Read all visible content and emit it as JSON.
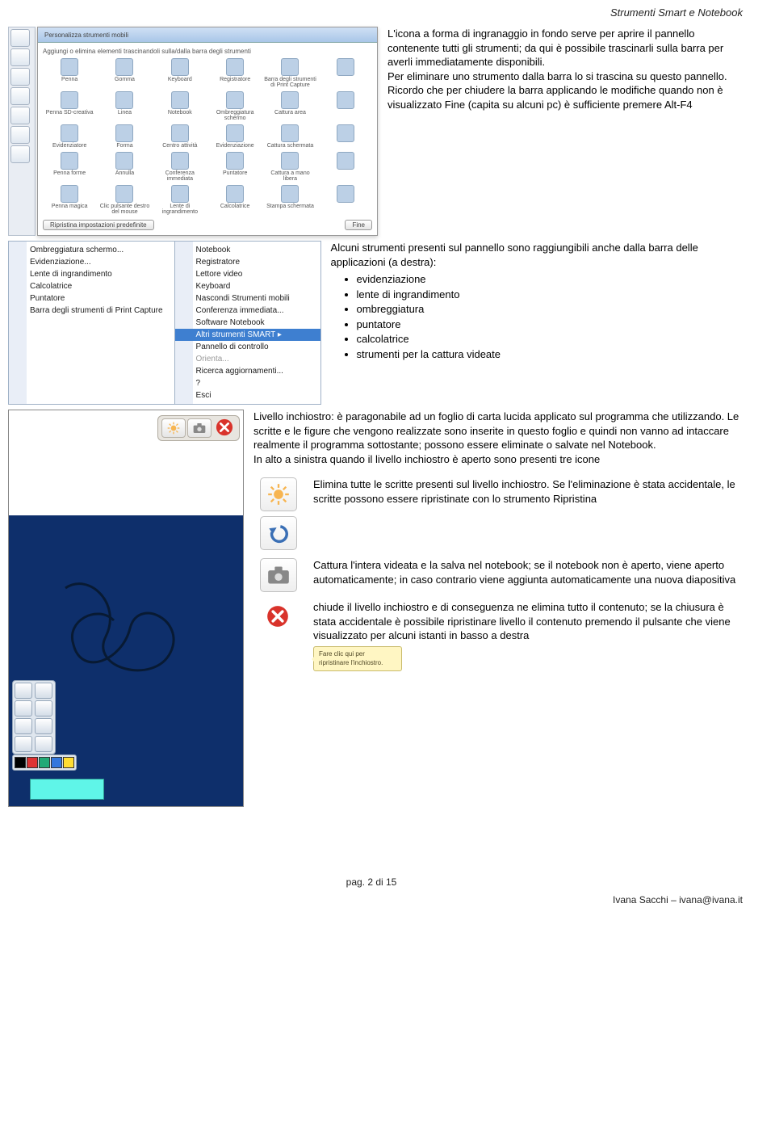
{
  "header": {
    "title": "Strumenti Smart e Notebook"
  },
  "toolpanel": {
    "title": "Personalizza strumenti mobili",
    "hint": "Aggiungi o elimina elementi trascinandoli sulla/dalla barra degli strumenti",
    "grid": [
      "Penna",
      "Gomma",
      "Keyboard",
      "Registratore",
      "Barra degli strumenti di Print Capture",
      "",
      "Penna SD-creativa",
      "Linea",
      "Notebook",
      "Ombreggiatura schermo",
      "Cattura area",
      "",
      "Evidenziatore",
      "Forma",
      "Centro attività",
      "Evidenziazione",
      "Cattura schermata",
      "",
      "Penna forme",
      "Annulla",
      "Conferenza immediata",
      "Puntatore",
      "Cattura a mano libera",
      "",
      "Penna magica",
      "Clic pulsante destro del mouse",
      "Lente di ingrandimento",
      "Calcolatrice",
      "Stampa schermata",
      ""
    ],
    "restore_btn": "Ripristina impostazioni predefinite",
    "done_btn": "Fine"
  },
  "para1": "L'icona a forma di ingranaggio in fondo serve per aprire il pannello contenente tutti gli strumenti; da qui è possibile trascinarli sulla barra per averli immediatamente disponibili.\nPer eliminare uno strumento dalla barra lo si trascina su questo pannello.\nRicordo che per chiudere la barra applicando le modifiche quando non è visualizzato Fine (capita su alcuni pc) è sufficiente premere Alt-F4",
  "menu_left": [
    "Ombreggiatura schermo...",
    "Evidenziazione...",
    "Lente di ingrandimento",
    "Calcolatrice",
    "Puntatore",
    "Barra degli strumenti di Print Capture"
  ],
  "menu_right": [
    {
      "t": "Notebook"
    },
    {
      "t": "Registratore"
    },
    {
      "t": "Lettore video"
    },
    {
      "t": "Keyboard"
    },
    {
      "t": "Nascondi Strumenti mobili"
    },
    {
      "t": "Conferenza immediata..."
    },
    {
      "t": "Software Notebook"
    },
    {
      "t": "Altri strumenti SMART",
      "sel": true,
      "arrow": true
    },
    {
      "t": "Pannello di controllo"
    },
    {
      "t": "Orienta...",
      "gray": true
    },
    {
      "t": "Ricerca aggiornamenti..."
    },
    {
      "t": "?"
    },
    {
      "t": "Esci"
    }
  ],
  "para2_intro": "Alcuni strumenti presenti sul pannello sono raggiungibili anche dalla barra delle applicazioni (a destra):",
  "para2_list": [
    "evidenziazione",
    "lente di ingrandimento",
    "ombreggiatura",
    "puntatore",
    "calcolatrice",
    "strumenti per la cattura videate"
  ],
  "para3a": "Livello inchiostro: è paragonabile ad un foglio di carta lucida applicato sul programma che utilizzando. Le scritte e le figure che vengono realizzate sono inserite in questo foglio e quindi non vanno ad intaccare realmente il programma sottostante; possono essere eliminate o salvate nel Notebook.",
  "para3b": "In alto a sinistra quando il livello inchiostro è aperto sono presenti tre icone",
  "icons": [
    {
      "name": "sunburst-icon",
      "desc": "Elimina tutte le scritte presenti sul livello inchiostro. Se l'eliminazione è stata accidentale, le scritte possono essere ripristinate con lo strumento Ripristina"
    },
    {
      "name": "camera-icon",
      "desc": "Cattura l'intera videata e la salva nel notebook; se il notebook non è aperto, viene aperto automaticamente; in caso contrario viene aggiunta automaticamente una nuova diapositiva"
    },
    {
      "name": "close-icon",
      "desc": "chiude il livello inchiostro e di conseguenza ne elimina tutto il contenuto; se la chiusura è stata accidentale è possibile ripristinare livello il contenuto premendo il pulsante che viene visualizzato per alcuni istanti in basso a destra"
    }
  ],
  "tooltip": "Fare clic qui per ripristinare l'inchiostro.",
  "footer": {
    "page": "pag. 2 di 15",
    "author": "Ivana Sacchi – ivana@ivana.it"
  }
}
